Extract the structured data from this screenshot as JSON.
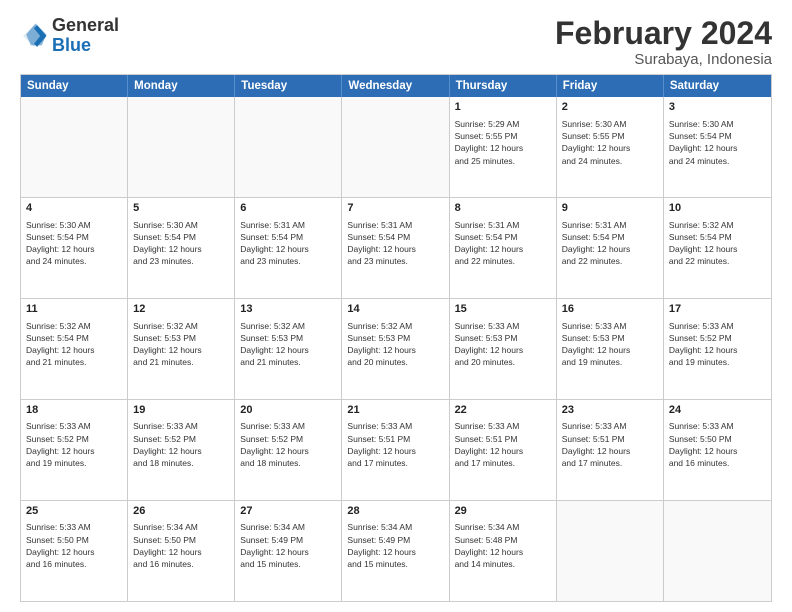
{
  "logo": {
    "text_general": "General",
    "text_blue": "Blue"
  },
  "header": {
    "title": "February 2024",
    "subtitle": "Surabaya, Indonesia"
  },
  "days_of_week": [
    "Sunday",
    "Monday",
    "Tuesday",
    "Wednesday",
    "Thursday",
    "Friday",
    "Saturday"
  ],
  "weeks": [
    [
      {
        "day": "",
        "info": ""
      },
      {
        "day": "",
        "info": ""
      },
      {
        "day": "",
        "info": ""
      },
      {
        "day": "",
        "info": ""
      },
      {
        "day": "1",
        "info": "Sunrise: 5:29 AM\nSunset: 5:55 PM\nDaylight: 12 hours\nand 25 minutes."
      },
      {
        "day": "2",
        "info": "Sunrise: 5:30 AM\nSunset: 5:55 PM\nDaylight: 12 hours\nand 24 minutes."
      },
      {
        "day": "3",
        "info": "Sunrise: 5:30 AM\nSunset: 5:54 PM\nDaylight: 12 hours\nand 24 minutes."
      }
    ],
    [
      {
        "day": "4",
        "info": "Sunrise: 5:30 AM\nSunset: 5:54 PM\nDaylight: 12 hours\nand 24 minutes."
      },
      {
        "day": "5",
        "info": "Sunrise: 5:30 AM\nSunset: 5:54 PM\nDaylight: 12 hours\nand 23 minutes."
      },
      {
        "day": "6",
        "info": "Sunrise: 5:31 AM\nSunset: 5:54 PM\nDaylight: 12 hours\nand 23 minutes."
      },
      {
        "day": "7",
        "info": "Sunrise: 5:31 AM\nSunset: 5:54 PM\nDaylight: 12 hours\nand 23 minutes."
      },
      {
        "day": "8",
        "info": "Sunrise: 5:31 AM\nSunset: 5:54 PM\nDaylight: 12 hours\nand 22 minutes."
      },
      {
        "day": "9",
        "info": "Sunrise: 5:31 AM\nSunset: 5:54 PM\nDaylight: 12 hours\nand 22 minutes."
      },
      {
        "day": "10",
        "info": "Sunrise: 5:32 AM\nSunset: 5:54 PM\nDaylight: 12 hours\nand 22 minutes."
      }
    ],
    [
      {
        "day": "11",
        "info": "Sunrise: 5:32 AM\nSunset: 5:54 PM\nDaylight: 12 hours\nand 21 minutes."
      },
      {
        "day": "12",
        "info": "Sunrise: 5:32 AM\nSunset: 5:53 PM\nDaylight: 12 hours\nand 21 minutes."
      },
      {
        "day": "13",
        "info": "Sunrise: 5:32 AM\nSunset: 5:53 PM\nDaylight: 12 hours\nand 21 minutes."
      },
      {
        "day": "14",
        "info": "Sunrise: 5:32 AM\nSunset: 5:53 PM\nDaylight: 12 hours\nand 20 minutes."
      },
      {
        "day": "15",
        "info": "Sunrise: 5:33 AM\nSunset: 5:53 PM\nDaylight: 12 hours\nand 20 minutes."
      },
      {
        "day": "16",
        "info": "Sunrise: 5:33 AM\nSunset: 5:53 PM\nDaylight: 12 hours\nand 19 minutes."
      },
      {
        "day": "17",
        "info": "Sunrise: 5:33 AM\nSunset: 5:52 PM\nDaylight: 12 hours\nand 19 minutes."
      }
    ],
    [
      {
        "day": "18",
        "info": "Sunrise: 5:33 AM\nSunset: 5:52 PM\nDaylight: 12 hours\nand 19 minutes."
      },
      {
        "day": "19",
        "info": "Sunrise: 5:33 AM\nSunset: 5:52 PM\nDaylight: 12 hours\nand 18 minutes."
      },
      {
        "day": "20",
        "info": "Sunrise: 5:33 AM\nSunset: 5:52 PM\nDaylight: 12 hours\nand 18 minutes."
      },
      {
        "day": "21",
        "info": "Sunrise: 5:33 AM\nSunset: 5:51 PM\nDaylight: 12 hours\nand 17 minutes."
      },
      {
        "day": "22",
        "info": "Sunrise: 5:33 AM\nSunset: 5:51 PM\nDaylight: 12 hours\nand 17 minutes."
      },
      {
        "day": "23",
        "info": "Sunrise: 5:33 AM\nSunset: 5:51 PM\nDaylight: 12 hours\nand 17 minutes."
      },
      {
        "day": "24",
        "info": "Sunrise: 5:33 AM\nSunset: 5:50 PM\nDaylight: 12 hours\nand 16 minutes."
      }
    ],
    [
      {
        "day": "25",
        "info": "Sunrise: 5:33 AM\nSunset: 5:50 PM\nDaylight: 12 hours\nand 16 minutes."
      },
      {
        "day": "26",
        "info": "Sunrise: 5:34 AM\nSunset: 5:50 PM\nDaylight: 12 hours\nand 16 minutes."
      },
      {
        "day": "27",
        "info": "Sunrise: 5:34 AM\nSunset: 5:49 PM\nDaylight: 12 hours\nand 15 minutes."
      },
      {
        "day": "28",
        "info": "Sunrise: 5:34 AM\nSunset: 5:49 PM\nDaylight: 12 hours\nand 15 minutes."
      },
      {
        "day": "29",
        "info": "Sunrise: 5:34 AM\nSunset: 5:48 PM\nDaylight: 12 hours\nand 14 minutes."
      },
      {
        "day": "",
        "info": ""
      },
      {
        "day": "",
        "info": ""
      }
    ]
  ]
}
